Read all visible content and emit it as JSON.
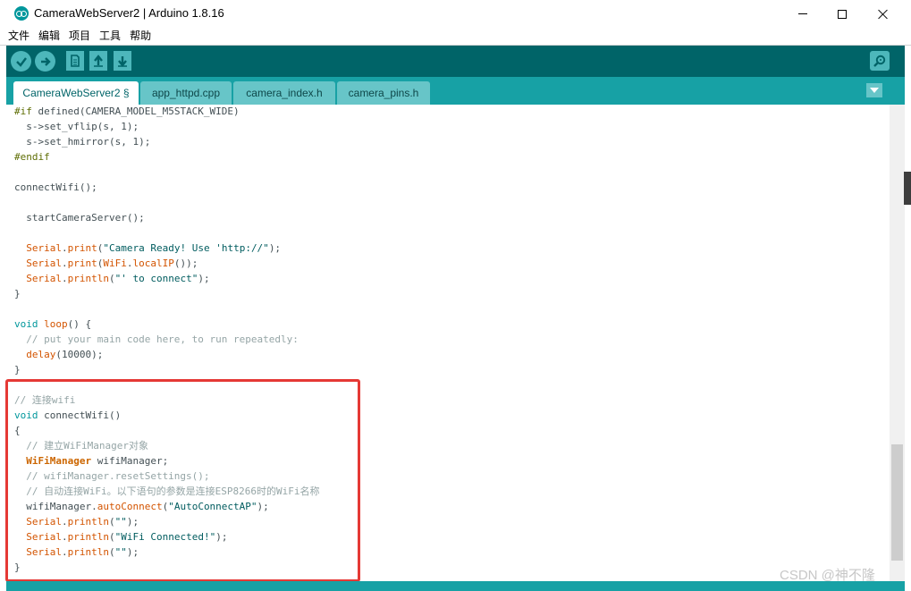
{
  "window": {
    "title": "CameraWebServer2 | Arduino 1.8.16"
  },
  "menu": {
    "items": [
      "文件",
      "编辑",
      "项目",
      "工具",
      "帮助"
    ]
  },
  "toolbar": {
    "buttons": [
      {
        "name": "verify",
        "icon": "check-icon"
      },
      {
        "name": "upload",
        "icon": "arrow-right-icon"
      },
      {
        "name": "new",
        "icon": "document-icon"
      },
      {
        "name": "open",
        "icon": "arrow-up-icon"
      },
      {
        "name": "save",
        "icon": "arrow-down-icon"
      }
    ],
    "serial_monitor_icon": "magnifier-icon"
  },
  "tabs": [
    {
      "label": "CameraWebServer2 §",
      "active": true
    },
    {
      "label": "app_httpd.cpp",
      "active": false
    },
    {
      "label": "camera_index.h",
      "active": false
    },
    {
      "label": "camera_pins.h",
      "active": false
    }
  ],
  "code": {
    "lines": [
      [
        [
          "#if ",
          "pre"
        ],
        [
          "defined(CAMERA_MODEL_M5STACK_WIDE)",
          "normal"
        ]
      ],
      [
        [
          "  s->",
          "normal"
        ],
        [
          "set_vflip",
          "normal"
        ],
        [
          "(s, 1);",
          "normal"
        ]
      ],
      [
        [
          "  s->",
          "normal"
        ],
        [
          "set_hmirror",
          "normal"
        ],
        [
          "(s, 1);",
          "normal"
        ]
      ],
      [
        [
          "#endif",
          "pre"
        ]
      ],
      [],
      [
        [
          "connectWifi();",
          "normal"
        ]
      ],
      [],
      [
        [
          "  startCameraServer();",
          "normal"
        ]
      ],
      [],
      [
        [
          "  ",
          "normal"
        ],
        [
          "Serial",
          "fn"
        ],
        [
          ".",
          "normal"
        ],
        [
          "print",
          "fn"
        ],
        [
          "(",
          "normal"
        ],
        [
          "\"Camera Ready! Use 'http://\"",
          "str"
        ],
        [
          ");",
          "normal"
        ]
      ],
      [
        [
          "  ",
          "normal"
        ],
        [
          "Serial",
          "fn"
        ],
        [
          ".",
          "normal"
        ],
        [
          "print",
          "fn"
        ],
        [
          "(",
          "normal"
        ],
        [
          "WiFi",
          "fn"
        ],
        [
          ".",
          "normal"
        ],
        [
          "localIP",
          "fn"
        ],
        [
          "());",
          "normal"
        ]
      ],
      [
        [
          "  ",
          "normal"
        ],
        [
          "Serial",
          "fn"
        ],
        [
          ".",
          "normal"
        ],
        [
          "println",
          "fn"
        ],
        [
          "(",
          "normal"
        ],
        [
          "\"' to connect\"",
          "str"
        ],
        [
          ");",
          "normal"
        ]
      ],
      [
        [
          "}",
          "normal"
        ]
      ],
      [],
      [
        [
          "void",
          "kw"
        ],
        [
          " ",
          "normal"
        ],
        [
          "loop",
          "fn"
        ],
        [
          "() {",
          "normal"
        ]
      ],
      [
        [
          "  // put your main code here, to run repeatedly:",
          "com"
        ]
      ],
      [
        [
          "  ",
          "normal"
        ],
        [
          "delay",
          "fn"
        ],
        [
          "(10000);",
          "normal"
        ]
      ],
      [
        [
          "}",
          "normal"
        ]
      ],
      [],
      [
        [
          "// 连接wifi",
          "com"
        ]
      ],
      [
        [
          "void",
          "kw"
        ],
        [
          " connectWifi()",
          "normal"
        ]
      ],
      [
        [
          "{",
          "normal"
        ]
      ],
      [
        [
          "  // 建立WiFiManager对象",
          "com"
        ]
      ],
      [
        [
          "  ",
          "normal"
        ],
        [
          "WiFiManager",
          "type"
        ],
        [
          " wifiManager;",
          "normal"
        ]
      ],
      [
        [
          "  // wifiManager.resetSettings();",
          "com"
        ]
      ],
      [
        [
          "  // 自动连接WiFi。以下语句的参数是连接ESP8266时的WiFi名称",
          "com"
        ]
      ],
      [
        [
          "  wifiManager.",
          "normal"
        ],
        [
          "autoConnect",
          "fn"
        ],
        [
          "(",
          "normal"
        ],
        [
          "\"AutoConnectAP\"",
          "str"
        ],
        [
          ");",
          "normal"
        ]
      ],
      [
        [
          "  ",
          "normal"
        ],
        [
          "Serial",
          "fn"
        ],
        [
          ".",
          "normal"
        ],
        [
          "println",
          "fn"
        ],
        [
          "(",
          "normal"
        ],
        [
          "\"\"",
          "str"
        ],
        [
          ");",
          "normal"
        ]
      ],
      [
        [
          "  ",
          "normal"
        ],
        [
          "Serial",
          "fn"
        ],
        [
          ".",
          "normal"
        ],
        [
          "println",
          "fn"
        ],
        [
          "(",
          "normal"
        ],
        [
          "\"WiFi Connected!\"",
          "str"
        ],
        [
          ");",
          "normal"
        ]
      ],
      [
        [
          "  ",
          "normal"
        ],
        [
          "Serial",
          "fn"
        ],
        [
          ".",
          "normal"
        ],
        [
          "println",
          "fn"
        ],
        [
          "(",
          "normal"
        ],
        [
          "\"\"",
          "str"
        ],
        [
          ");",
          "normal"
        ]
      ],
      [
        [
          "}",
          "normal"
        ]
      ]
    ]
  },
  "watermark": "CSDN @神不隆",
  "colors": {
    "toolbar": "#006468",
    "tabbar": "#17a1a5",
    "button": "#4db7bb",
    "highlight": "#e53935"
  }
}
